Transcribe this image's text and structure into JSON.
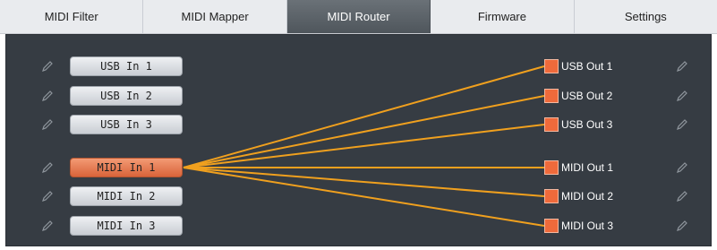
{
  "tabs": [
    {
      "label": "MIDI Filter",
      "active": false
    },
    {
      "label": "MIDI Mapper",
      "active": false
    },
    {
      "label": "MIDI Router",
      "active": true
    },
    {
      "label": "Firmware",
      "active": false
    },
    {
      "label": "Settings",
      "active": false
    }
  ],
  "inputs": [
    {
      "label": "USB In 1",
      "active": false
    },
    {
      "label": "USB In 2",
      "active": false
    },
    {
      "label": "USB In 3",
      "active": false
    },
    {
      "label": "MIDI In 1",
      "active": true
    },
    {
      "label": "MIDI In 2",
      "active": false
    },
    {
      "label": "MIDI In 3",
      "active": false
    }
  ],
  "outputs": [
    {
      "label": "USB Out 1"
    },
    {
      "label": "USB Out 2"
    },
    {
      "label": "USB Out 3"
    },
    {
      "label": "MIDI Out 1"
    },
    {
      "label": "MIDI Out 2"
    },
    {
      "label": "MIDI Out 3"
    }
  ],
  "routes": [
    {
      "from": "MIDI In 1",
      "to": "USB Out 1"
    },
    {
      "from": "MIDI In 1",
      "to": "USB Out 2"
    },
    {
      "from": "MIDI In 1",
      "to": "USB Out 3"
    },
    {
      "from": "MIDI In 1",
      "to": "MIDI Out 1"
    },
    {
      "from": "MIDI In 1",
      "to": "MIDI Out 2"
    },
    {
      "from": "MIDI In 1",
      "to": "MIDI Out 3"
    }
  ],
  "colors": {
    "accent": "#ef6a3b",
    "wire": "#f0a01e",
    "panel": "#363c43",
    "tab_active": "#5c6369"
  },
  "icons": {
    "edit": "pencil-icon"
  }
}
